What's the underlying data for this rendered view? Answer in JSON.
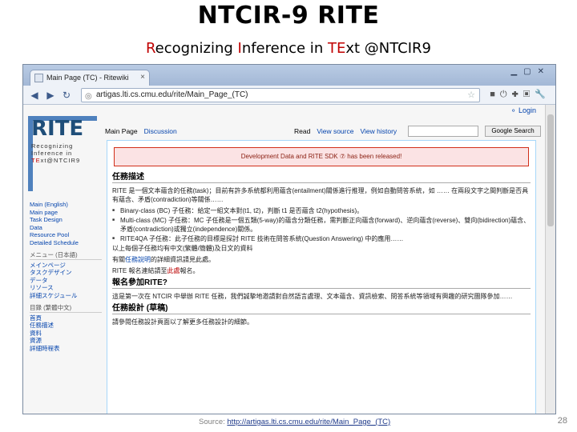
{
  "slide": {
    "title": "NTCIR-9 RITE",
    "subtitle": {
      "r1": "R",
      "t1": "ecognizing ",
      "r2": "I",
      "t2": "nference in ",
      "r3": "TE",
      "t3": "xt @NTCIR9"
    },
    "source_label": "Source:",
    "source_url": "http://artigas.lti.cs.cmu.edu/rite/Main_Page_(TC)",
    "page_number": "28"
  },
  "browser": {
    "tab_title": "Main Page (TC) - Ritewiki",
    "url": "artigas.lti.cs.cmu.edu/rite/Main_Page_(TC)"
  },
  "wiki": {
    "login": "Login",
    "logo_text": "RITE",
    "logo_sub": [
      "Recognizing",
      "Inference in"
    ],
    "logo_sub_last": {
      "a": "TE",
      "b": "xt@NTCIR9"
    },
    "tabs_left": [
      "Main Page",
      "Discussion"
    ],
    "tabs_right": [
      "Read",
      "View source",
      "View history"
    ],
    "search_button": "Google Search",
    "notice": "Development Data and RITE SDK ⑦ has been released!",
    "section_heading": "任務描述",
    "para1": "RITE 是一個文本蘊含的任務(task)；目前有許多系統都利用蘊含(entailment)關係進行推理，例如自動問答系統，如 …… 在兩段文字之間判斷是否具有蘊含、矛盾(contradiction)等關係……",
    "bullets": [
      "Binary-class (BC) 子任務：給定一組文本對(t1, t2)，判斷 t1 是否蘊含 t2(hypothesis)。",
      "Multi-class (MC) 子任務：MC 子任務是一個五類(5-way)的蘊含分類任務，需判斷正向蘊含(forward)、逆向蘊含(reverse)、雙向(bidirection)蘊含、矛盾(contradiction)或獨立(independence)關係。",
      "RITE4QA 子任務：此子任務的目標是探討 RITE 技術在問答系統(Question Answering) 中的應用……"
    ],
    "para2": "以上每個子任務均有中文(繁體/簡體)及日文的資料",
    "line3_prefix": "有關",
    "line3_link": "任務說明",
    "line3_suffix": "的詳細資訊請見此處。",
    "line4_prefix": "RITE 報名連結請至",
    "line4_link": "此處",
    "line4_suffix": "報名。",
    "section2": "報名參加RITE?",
    "para3": "這是第一次在 NTCIR 中舉辦 RITE 任務，我們誠摯地邀請對自然語言處理、文本蘊含、資訊檢索、問答系統等領域有興趣的研究團隊參加……",
    "section3": "任務設計 (草稿)",
    "para4": "請參閱任務設計頁面以了解更多任務設計的細節。"
  },
  "sidebar": {
    "top_links": [
      "Main (English)",
      "Main page",
      "Task Design",
      "Data",
      "Resource Pool",
      "Detailed Schedule"
    ],
    "ja_title": "メニュー (日本語)",
    "ja_links": [
      "メインページ",
      "タスクデザイン",
      "データ",
      "リソース",
      "詳細スケジュール"
    ],
    "zh_title": "目錄 (繁體中文)",
    "zh_links": [
      "首頁",
      "任務描述",
      "資料",
      "資源",
      "詳細時程表"
    ]
  }
}
